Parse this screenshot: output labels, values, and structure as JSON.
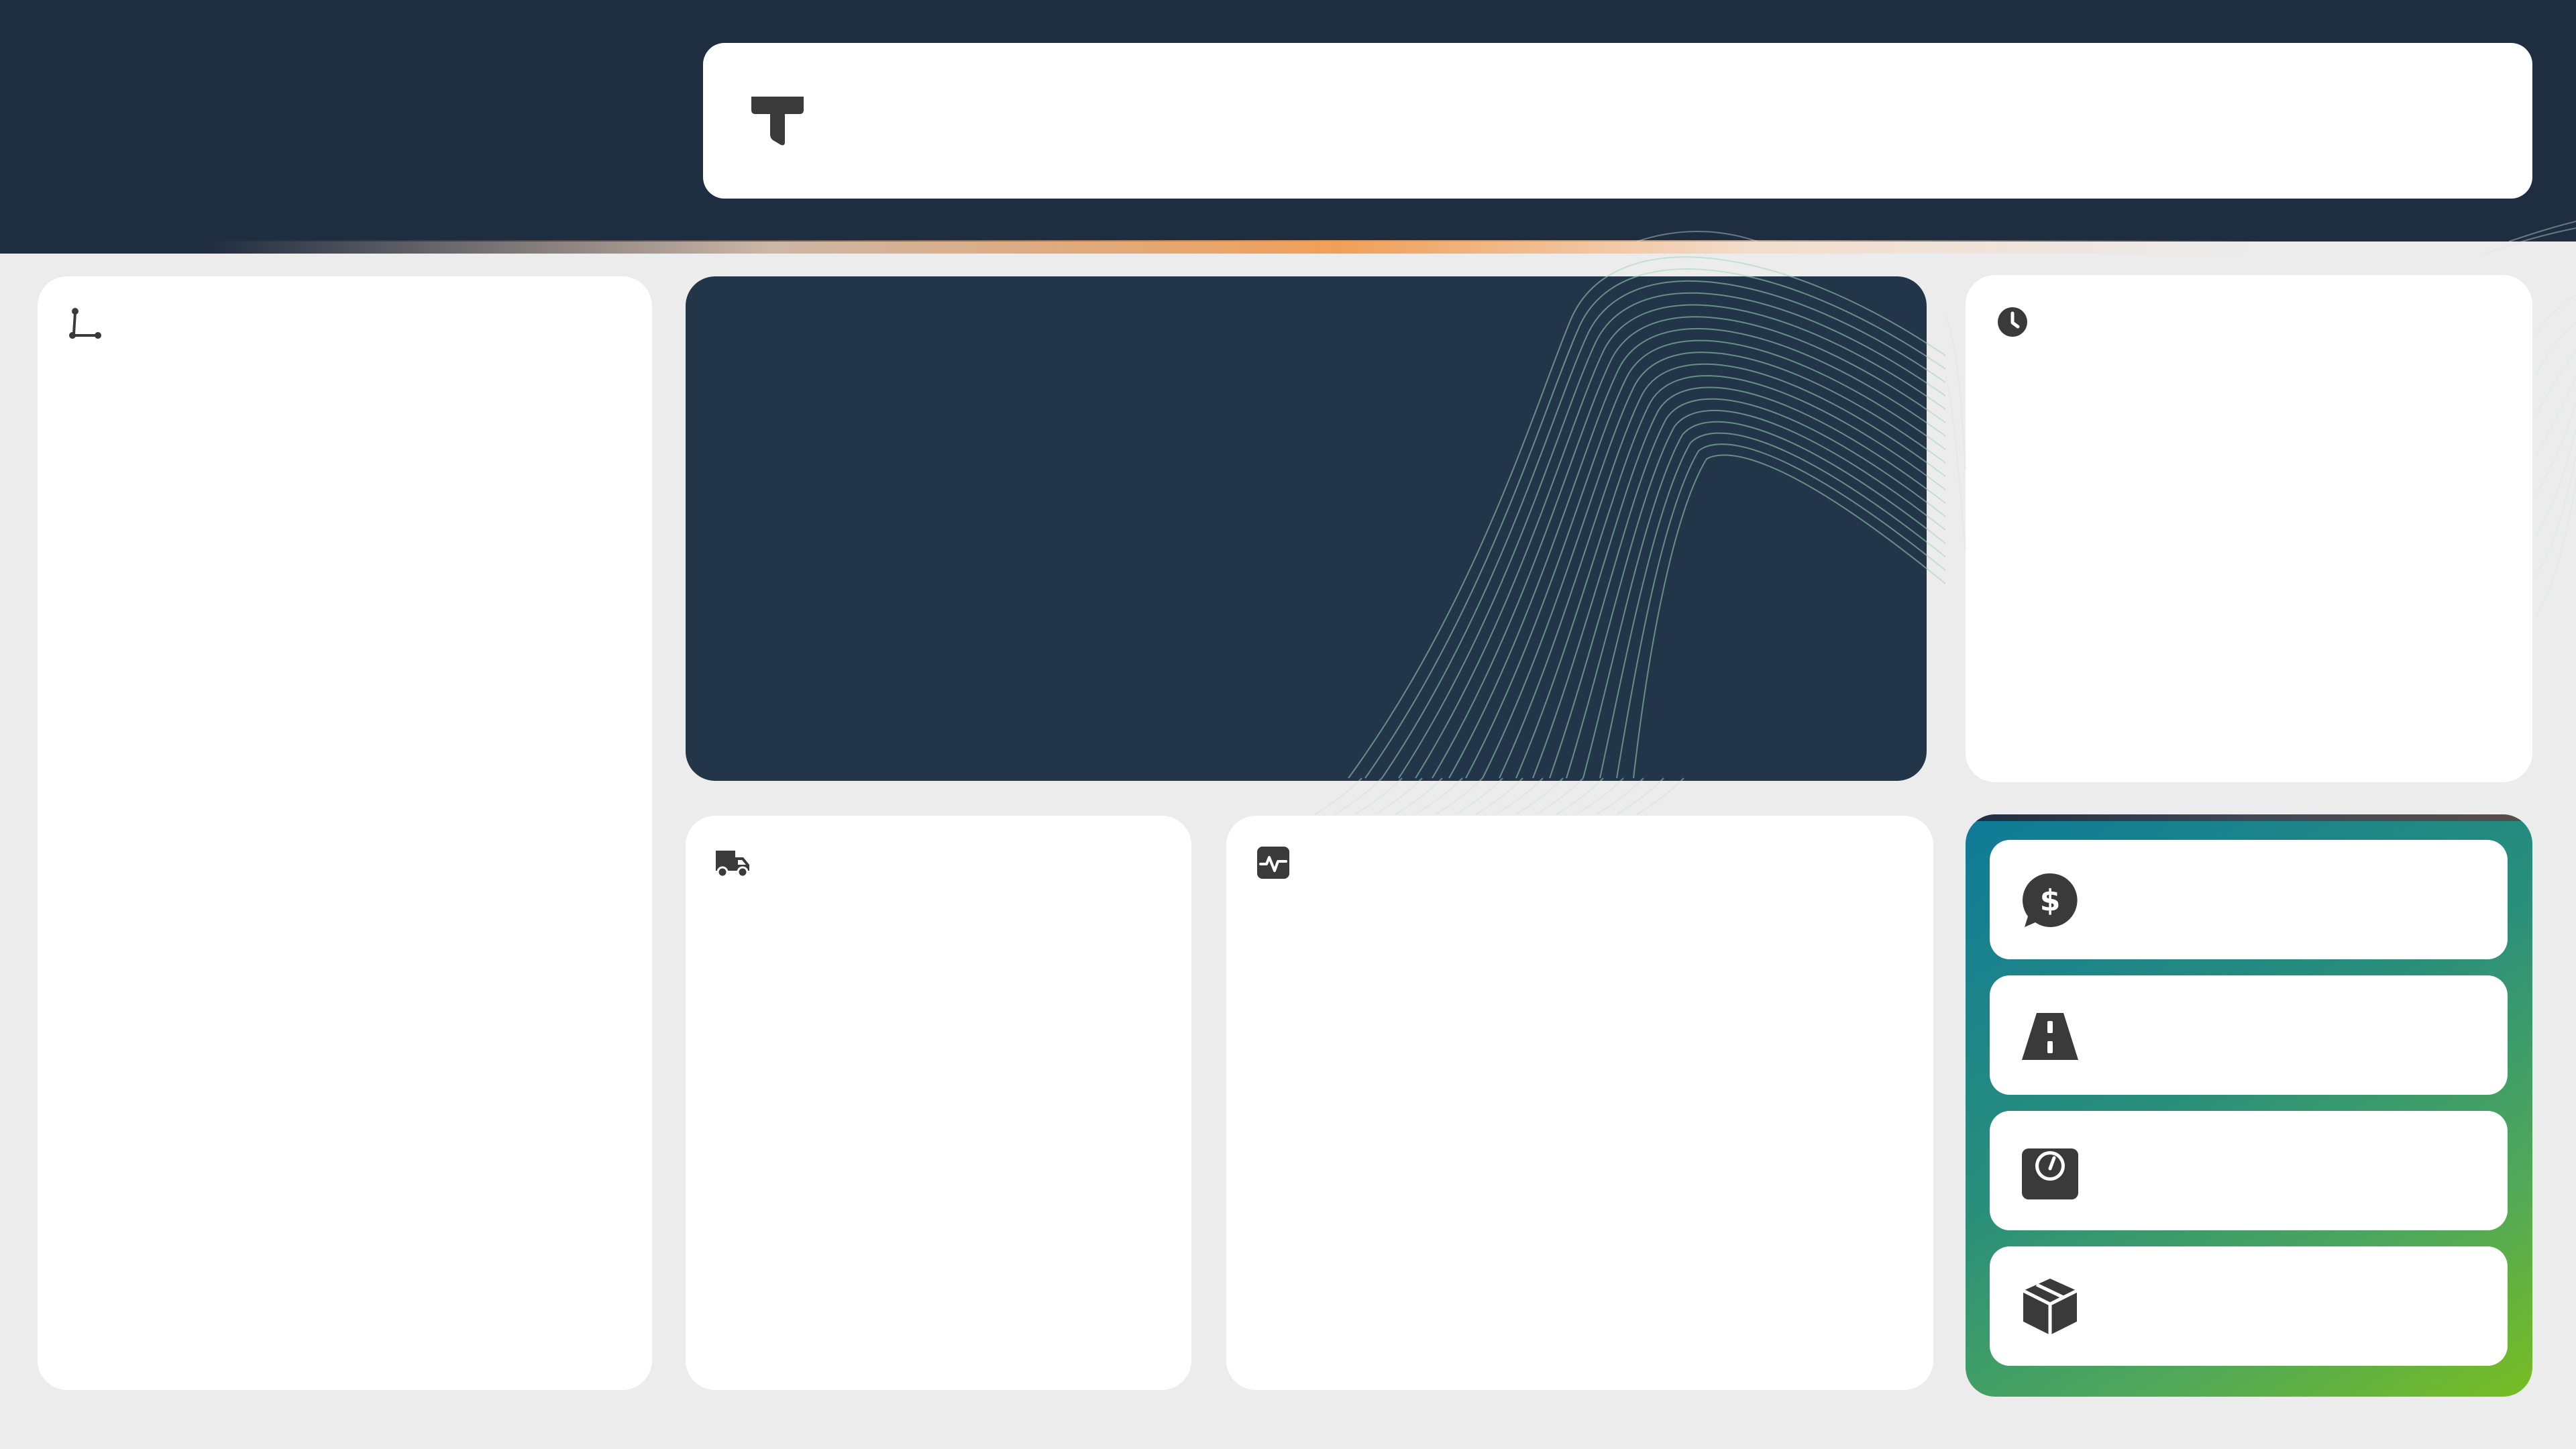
{
  "header": {
    "filter_bar": {
      "icon": "filter-icon"
    }
  },
  "cards": {
    "routes": {
      "icon": "route-icon"
    },
    "schedule": {
      "icon": "clock-icon"
    },
    "fleet": {
      "icon": "truck-icon"
    },
    "activity": {
      "icon": "activity-icon"
    }
  },
  "metrics": {
    "items": [
      {
        "icon": "dollar-chat-icon"
      },
      {
        "icon": "road-icon"
      },
      {
        "icon": "weight-scale-icon"
      },
      {
        "icon": "package-icon"
      }
    ]
  },
  "colors": {
    "header_bg": "#1f2d40",
    "hero_bg": "#233649",
    "page_bg": "#ececec",
    "accent_orange": "#f09b50",
    "panel_gradient_start": "#0f7a98",
    "panel_gradient_end": "#78bd22",
    "icon_color": "#3a3a3a",
    "wave_line": "#9fd8b8"
  }
}
